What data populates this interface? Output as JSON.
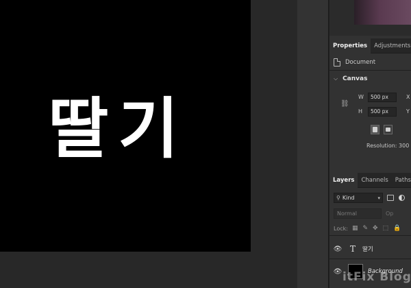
{
  "canvas": {
    "text": "딸기",
    "background": "#000000",
    "text_color": "#ffffff"
  },
  "properties_panel": {
    "tabs": [
      {
        "label": "Properties"
      },
      {
        "label": "Adjustments"
      }
    ],
    "document_label": "Document",
    "section_title": "Canvas",
    "width_label": "W",
    "width_value": "500 px",
    "x_label": "X",
    "height_label": "H",
    "height_value": "500 px",
    "y_label": "Y",
    "resolution_text": "Resolution: 300"
  },
  "layers_panel": {
    "tabs": [
      {
        "label": "Layers"
      },
      {
        "label": "Channels"
      },
      {
        "label": "Paths"
      }
    ],
    "filter_kind": "Kind",
    "blend_mode": "Normal",
    "opacity_label": "Op",
    "lock_label": "Lock:",
    "layers": [
      {
        "type_glyph": "T",
        "name": "딸기"
      },
      {
        "name": "Background"
      }
    ]
  },
  "watermark": "itFix Blog"
}
